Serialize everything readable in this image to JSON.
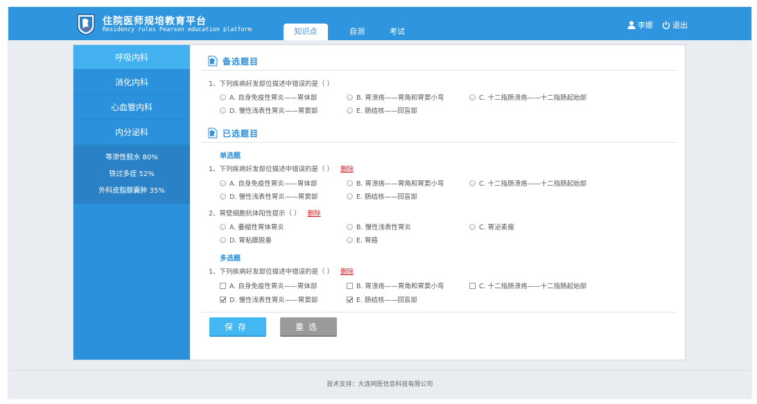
{
  "header": {
    "title_cn": "住院医师规培教育平台",
    "title_en": "Residency rules Pearson education platform",
    "tabs": [
      {
        "label": "知识点",
        "active": true
      },
      {
        "label": "自测",
        "active": false
      },
      {
        "label": "考试",
        "active": false
      }
    ],
    "user_name": "李娜",
    "logout_label": "退出",
    "user_icon": "user-icon",
    "logout_icon": "power-icon"
  },
  "sidebar": {
    "items": [
      {
        "label": "呼吸内科",
        "active": true
      },
      {
        "label": "消化内科",
        "active": false
      },
      {
        "label": "心血管内科",
        "active": false
      },
      {
        "label": "内分泌科",
        "active": false
      }
    ],
    "stats": [
      "等渗性脱水  80%",
      "铁过多症  52%",
      "外科皮脂腺囊肿  35%"
    ]
  },
  "candidate": {
    "title": "备选题目",
    "question": "1、下列疾病好发部位描述中错误的是（ ）",
    "options": [
      "A. 自身免疫性胃炎——胃体部",
      "B. 胃溃疡——胃角和胃窦小弯",
      "C. 十二指肠溃疡——十二指肠起始部",
      "D. 慢性浅表性胃炎——胃窦部",
      "E. 肠结核——回盲部"
    ]
  },
  "selected": {
    "title": "已选题目",
    "single_label": "单选题",
    "multi_label": "多选题",
    "delete_label": "删除",
    "q1": {
      "text": "1、下列疾病好发部位描述中错误的是（ ）",
      "options": [
        "A. 自身免疫性胃炎——胃体部",
        "B. 胃溃疡——胃角和胃窦小弯",
        "C. 十二指肠溃疡——十二指肠起始部",
        "D. 慢性浅表性胃炎——胃窦部",
        "E. 肠结核——回盲部"
      ]
    },
    "q2": {
      "text": "2、胃壁细胞抗体阳性提示（ ）",
      "options": [
        "A. 萎缩性胃体胃炎",
        "B. 慢性浅表性胃炎",
        "C. 胃泌素瘤",
        "D. 胃粘膜脱垂",
        "E. 胃癌"
      ]
    },
    "q3": {
      "text": "1、下列疾病好发部位描述中错误的是（ ）",
      "options": [
        "A. 自身免疫性胃炎——胃体部",
        "B. 胃溃疡——胃角和胃窦小弯",
        "C. 十二指肠溃疡——十二指肠起始部",
        "D. 慢性浅表性胃炎——胃窦部",
        "E. 肠结核——回盲部"
      ],
      "checked": [
        false,
        false,
        false,
        true,
        true
      ]
    }
  },
  "buttons": {
    "save": "保存",
    "reset": "重选"
  },
  "footer": {
    "text": "技术支持：大连网医信息科技有限公司"
  },
  "colors": {
    "header_bg": "#2e95de",
    "sidebar_bg": "#2b91dc",
    "sidebar_active": "#43b0f0",
    "accent": "#2b8ed8",
    "delete_link": "#e0171f",
    "save_button": "#42b7f1",
    "reset_button": "#9a9a9a"
  }
}
